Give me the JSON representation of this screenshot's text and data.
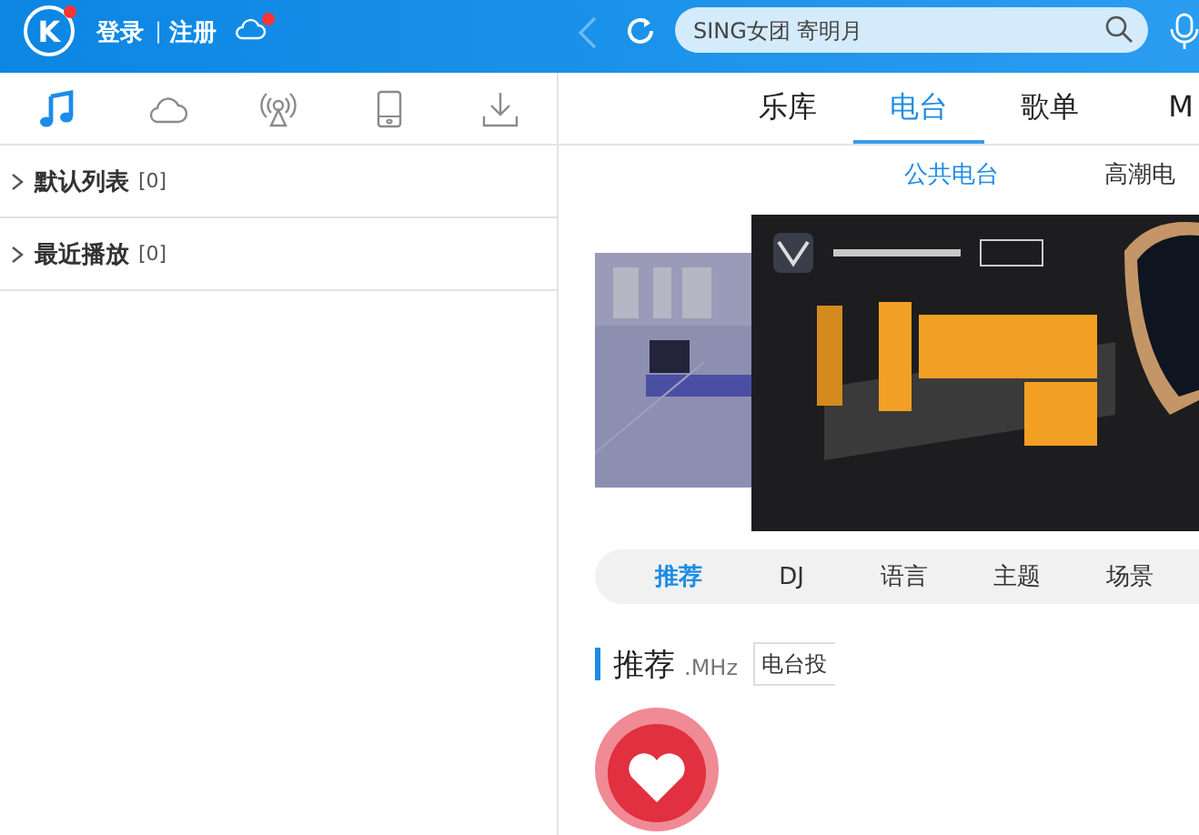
{
  "header": {
    "logo": {
      "letter": "K",
      "unread": true
    },
    "login": "登录",
    "separator": "|",
    "register": "注册",
    "cloud": {
      "unread": true
    },
    "search": {
      "placeholder": "SING女团 寄明月"
    }
  },
  "sidebar": {
    "tabs": [
      {
        "kind": "music",
        "selected": true
      },
      {
        "kind": "cloud",
        "selected": false
      },
      {
        "kind": "radio",
        "selected": false
      },
      {
        "kind": "phone",
        "selected": false
      },
      {
        "kind": "download",
        "selected": false
      }
    ],
    "lists": [
      {
        "label": "默认列表",
        "count": "[0]",
        "expanded": false
      },
      {
        "label": "最近播放",
        "count": "[0]",
        "expanded": false
      }
    ]
  },
  "main": {
    "tabs": [
      {
        "label": "乐库",
        "selected": false
      },
      {
        "label": "电台",
        "selected": true
      },
      {
        "label": "歌单",
        "selected": false
      },
      {
        "label": "M",
        "selected": false
      }
    ],
    "subtabs": [
      {
        "label": "公共电台",
        "selected": true
      },
      {
        "label": "高潮电",
        "selected": false
      }
    ],
    "categories": [
      {
        "label": "推荐",
        "selected": true
      },
      {
        "label": "DJ",
        "selected": false
      },
      {
        "label": "语言",
        "selected": false
      },
      {
        "label": "主题",
        "selected": false
      },
      {
        "label": "场景",
        "selected": false
      }
    ],
    "section": {
      "title": "推荐",
      "subtitle": ".MHz",
      "button": "电台投"
    }
  }
}
